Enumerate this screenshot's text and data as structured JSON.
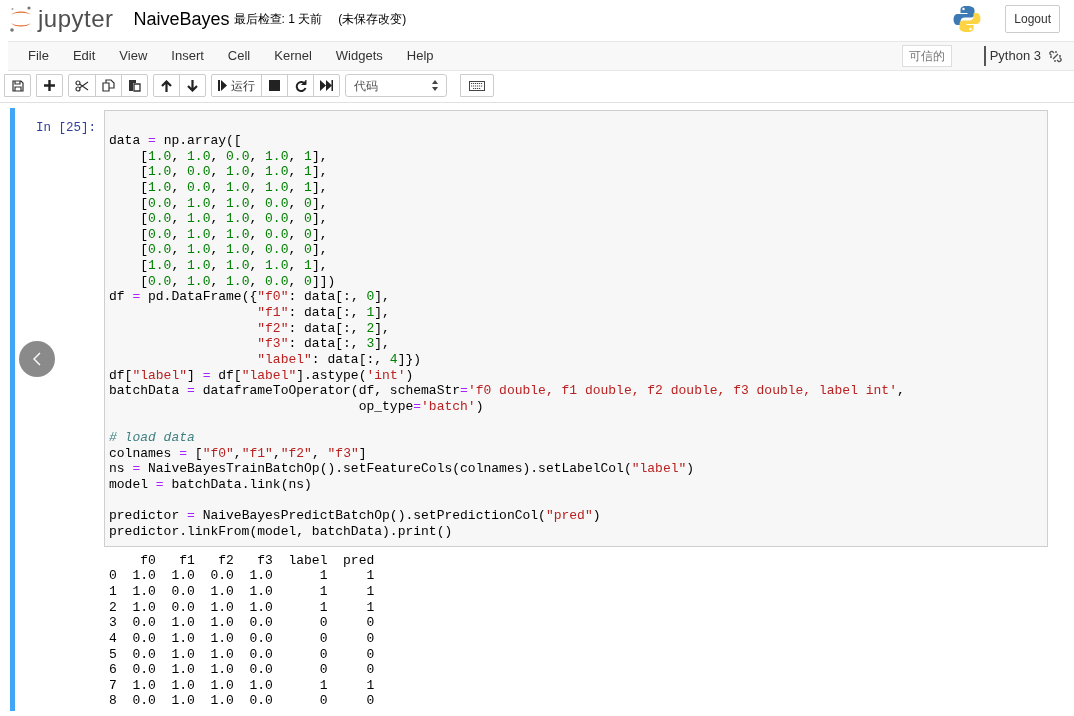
{
  "header": {
    "logo_text": "jupyter",
    "notebook_name": "NaiveBayes",
    "checkpoint": "最后检查: 1 天前",
    "save_status": "(未保存改变)",
    "logout": "Logout"
  },
  "menu": [
    "File",
    "Edit",
    "View",
    "Insert",
    "Cell",
    "Kernel",
    "Widgets",
    "Help"
  ],
  "trusted": "可信的",
  "kernel_name": "Python 3",
  "toolbar": {
    "run_label": "运行",
    "cell_type": "代码"
  },
  "cell": {
    "prompt": "In [25]:",
    "selected": true,
    "code_blocks": [
      [
        "data = np.array([",
        "    [1.0, 1.0, 0.0, 1.0, 1],",
        "    [1.0, 0.0, 1.0, 1.0, 1],",
        "    [1.0, 0.0, 1.0, 1.0, 1],",
        "    [0.0, 1.0, 1.0, 0.0, 0],",
        "    [0.0, 1.0, 1.0, 0.0, 0],",
        "    [0.0, 1.0, 1.0, 0.0, 0],",
        "    [0.0, 1.0, 1.0, 0.0, 0],",
        "    [1.0, 1.0, 1.0, 1.0, 1],",
        "    [0.0, 1.0, 1.0, 0.0, 0]])",
        "df = pd.DataFrame({\"f0\": data[:, 0],",
        "                   \"f1\": data[:, 1],",
        "                   \"f2\": data[:, 2],",
        "                   \"f3\": data[:, 3],",
        "                   \"label\": data[:, 4]})",
        "df[\"label\"] = df[\"label\"].astype('int')",
        "batchData = dataframeToOperator(df, schemaStr='f0 double, f1 double, f2 double, f3 double, label int',",
        "                                op_type='batch')"
      ],
      [
        "# load data",
        "colnames = [\"f0\",\"f1\",\"f2\", \"f3\"]",
        "ns = NaiveBayesTrainBatchOp().setFeatureCols(colnames).setLabelCol(\"label\")",
        "model = batchData.link(ns)"
      ],
      [
        "predictor = NaiveBayesPredictBatchOp().setPredictionCol(\"pred\")",
        "predictor.linkFrom(model, batchData).print()"
      ]
    ],
    "output_lines": [
      "    f0   f1   f2   f3  label  pred",
      "0  1.0  1.0  0.0  1.0      1     1",
      "1  1.0  0.0  1.0  1.0      1     1",
      "2  1.0  0.0  1.0  1.0      1     1",
      "3  0.0  1.0  1.0  0.0      0     0",
      "4  0.0  1.0  1.0  0.0      0     0",
      "5  0.0  1.0  1.0  0.0      0     0",
      "6  0.0  1.0  1.0  0.0      0     0",
      "7  1.0  1.0  1.0  1.0      1     1",
      "8  0.0  1.0  1.0  0.0      0     0"
    ]
  }
}
